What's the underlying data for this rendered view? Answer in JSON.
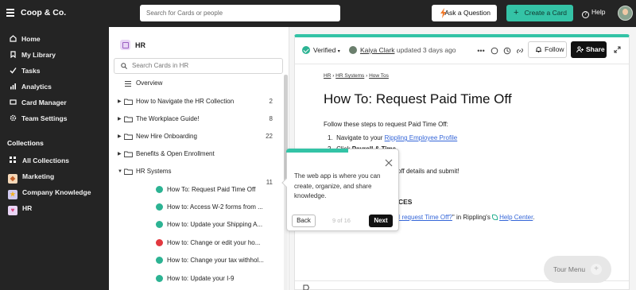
{
  "topbar": {
    "brand": "Coop & Co.",
    "search_placeholder": "Search for Cards or people",
    "ask_label": "Ask a Question",
    "create_label": "Create a Card",
    "help_label": "Help",
    "accent_color": "#34c3a6"
  },
  "nav": {
    "items": [
      {
        "label": "Home",
        "icon": "home-icon"
      },
      {
        "label": "My Library",
        "icon": "bookmark-icon"
      },
      {
        "label": "Tasks",
        "icon": "tasks-icon"
      },
      {
        "label": "Analytics",
        "icon": "analytics-icon"
      },
      {
        "label": "Card Manager",
        "icon": "card-manager-icon"
      },
      {
        "label": "Team Settings",
        "icon": "gear-icon"
      }
    ],
    "collections_heading": "Collections",
    "collections": [
      {
        "label": "All Collections",
        "icon": "grid-icon"
      },
      {
        "label": "Marketing",
        "icon": "marketing-emoji-icon"
      },
      {
        "label": "Company Knowledge",
        "icon": "star-icon"
      },
      {
        "label": "HR",
        "icon": "heart-icon"
      }
    ]
  },
  "panel": {
    "title": "HR",
    "search_placeholder": "Search Cards in HR",
    "overview_label": "Overview",
    "folders": [
      {
        "label": "How to Navigate the HR Collection",
        "count": "2"
      },
      {
        "label": "The Workplace Guide!",
        "count": "8"
      },
      {
        "label": "New Hire Onboarding",
        "count": "22"
      },
      {
        "label": "Benefits & Open Enrollment",
        "count": ""
      },
      {
        "label": "HR Systems",
        "count": "11"
      }
    ],
    "cards": [
      {
        "label": "How To: Request Paid Time Off",
        "status": "verified"
      },
      {
        "label": "How to: Access W-2 forms from ...",
        "status": "verified"
      },
      {
        "label": "How to: Update your Shipping A...",
        "status": "verified"
      },
      {
        "label": "How to: Change or edit your ho...",
        "status": "unverified"
      },
      {
        "label": "How to: Change your tax withhol...",
        "status": "verified"
      },
      {
        "label": "How to: Update your I-9",
        "status": "verified"
      }
    ]
  },
  "card": {
    "verified_label": "Verified",
    "author": "Kaiya Clark",
    "updated": "updated 3 days ago",
    "follow_label": "Follow",
    "share_label": "Share",
    "breadcrumb": [
      "HR",
      "HR Systems",
      "How Tos"
    ],
    "title": "How To: Request Paid Time Off",
    "intro": "Follow these steps to request Paid Time Off:",
    "step1_prefix": "Navigate to your ",
    "step1_link": "Rippling Employee Profile",
    "step2_prefix": "Click ",
    "step2_bold": "Payroll & Time",
    "step3_fragment": "off details and submit!",
    "resources_fragment": "CES",
    "resource_link": "I request Time Off?",
    "resource_mid": "\" in Rippling's ",
    "resource_help": "Help Center",
    "resource_end": "."
  },
  "tour": {
    "body": "The web app is where you can create, organize, and share knowledge.",
    "back_label": "Back",
    "progress": "9 of 16",
    "next_label": "Next",
    "menu_label": "Tour Menu"
  }
}
